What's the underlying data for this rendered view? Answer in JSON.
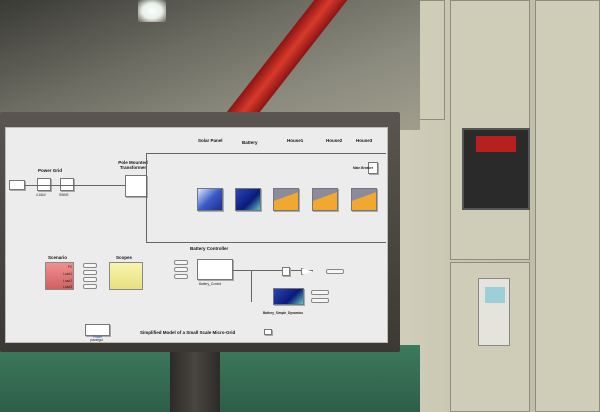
{
  "diagram": {
    "title": "Simplified Model of a Small Scale Micro-Grid",
    "sections": {
      "power_grid": "Power Grid",
      "transformer": "Pole Mounted Transformer",
      "solar_panel": "Solar Panel",
      "battery": "Battery",
      "house1": "House1",
      "house2": "House2",
      "house3": "House3",
      "scenario": "Scenario",
      "scopes": "Scopes",
      "battery_controller": "Battery Controller"
    },
    "block_captions": {
      "grid_voltage": "4.16kV",
      "grid_switch": "SWNS",
      "battery_control": "Battery_Control",
      "battery_dynamics": "Battery_Simple_Dynamics",
      "powergui": "powergui",
      "powergui_label": "Power",
      "main_breaker": "Main Breaker"
    },
    "scenario_ports": [
      "PV",
      "Load1",
      "Load2",
      "Load3"
    ]
  },
  "colors": {
    "scenario": "#e07070",
    "scopes": "#f4f0a0",
    "beam": "#c82a20"
  }
}
